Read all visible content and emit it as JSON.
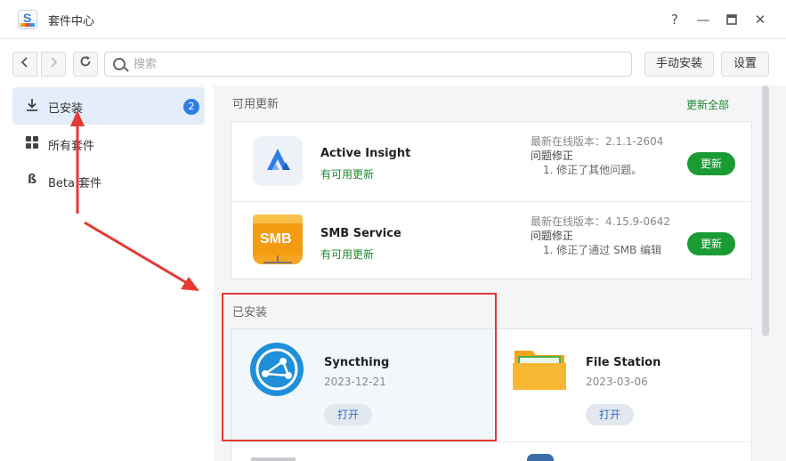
{
  "window": {
    "title": "套件中心"
  },
  "toolbar": {
    "search_placeholder": "搜索",
    "manual_install": "手动安装",
    "settings": "设置"
  },
  "sidebar": {
    "items": [
      {
        "label": "已安装",
        "badge": "2",
        "icon": "download-icon"
      },
      {
        "label": "所有套件",
        "icon": "grid-icon"
      },
      {
        "label": "Beta 套件",
        "icon": "beta-icon"
      }
    ]
  },
  "updates": {
    "title": "可用更新",
    "update_all": "更新全部",
    "items": [
      {
        "name": "Active Insight",
        "status": "有可用更新",
        "latest": "最新在线版本：2.1.1-2604",
        "fix_title": "问题修正",
        "fix_item": "1. 修正了其他问题。",
        "button": "更新"
      },
      {
        "name": "SMB Service",
        "status": "有可用更新",
        "latest": "最新在线版本：4.15.9-0642",
        "fix_title": "问题修正",
        "fix_item": "1. 修正了通过 SMB 编辑",
        "button": "更新",
        "icon_text": "SMB"
      }
    ]
  },
  "installed": {
    "title": "已安装",
    "items": [
      {
        "name": "Syncthing",
        "date": "2023-12-21",
        "button": "打开"
      },
      {
        "name": "File Station",
        "date": "2023-03-06",
        "button": "打开"
      }
    ]
  },
  "colors": {
    "accent": "#2f7ee6",
    "update_green": "#1a9b33",
    "annotation_red": "#e53935"
  }
}
